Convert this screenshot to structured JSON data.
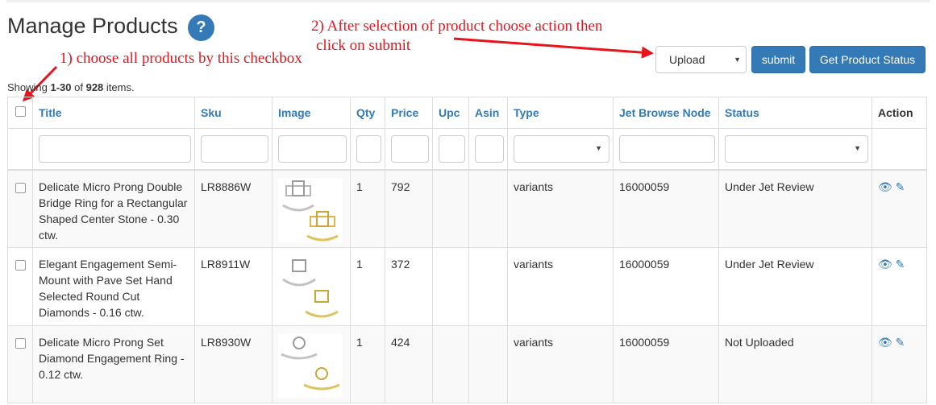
{
  "page": {
    "title": "Manage Products",
    "help_icon": "?"
  },
  "annotations": {
    "step1": "1) choose all products by this checkbox",
    "step2_line1": "2) After selection of product choose action then",
    "step2_line2": "click on submit",
    "color": "#e8141c"
  },
  "toolbar": {
    "action_value": "Upload",
    "submit_label": "submit",
    "status_label": "Get Product Status"
  },
  "summary": {
    "prefix": "Showing ",
    "range": "1-30",
    "of": " of ",
    "total": "928",
    "suffix": " items."
  },
  "table": {
    "columns": [
      "Title",
      "Sku",
      "Image",
      "Qty",
      "Price",
      "Upc",
      "Asin",
      "Type",
      "Jet Browse Node",
      "Status",
      "Action"
    ],
    "rows": [
      {
        "title": "Delicate Micro Prong Double Bridge Ring for a Rectangular Shaped Center Stone - 0.30 ctw.",
        "sku": "LR8886W",
        "qty": "1",
        "price": "792",
        "upc": "",
        "asin": "",
        "type": "variants",
        "node": "16000059",
        "status": "Under Jet Review"
      },
      {
        "title": "Elegant Engagement Semi-Mount with Pave Set Hand Selected Round Cut Diamonds - 0.16 ctw.",
        "sku": "LR8911W",
        "qty": "1",
        "price": "372",
        "upc": "",
        "asin": "",
        "type": "variants",
        "node": "16000059",
        "status": "Under Jet Review"
      },
      {
        "title": "Delicate Micro Prong Set Diamond Engagement Ring - 0.12 ctw.",
        "sku": "LR8930W",
        "qty": "1",
        "price": "424",
        "upc": "",
        "asin": "",
        "type": "variants",
        "node": "16000059",
        "status": "Not Uploaded"
      }
    ]
  },
  "icons": {
    "view": "eye-icon",
    "edit": "pencil-icon",
    "dropdown": "caret-down-icon"
  },
  "colors": {
    "accent": "#337ab7",
    "annotation": "#e8141c"
  }
}
